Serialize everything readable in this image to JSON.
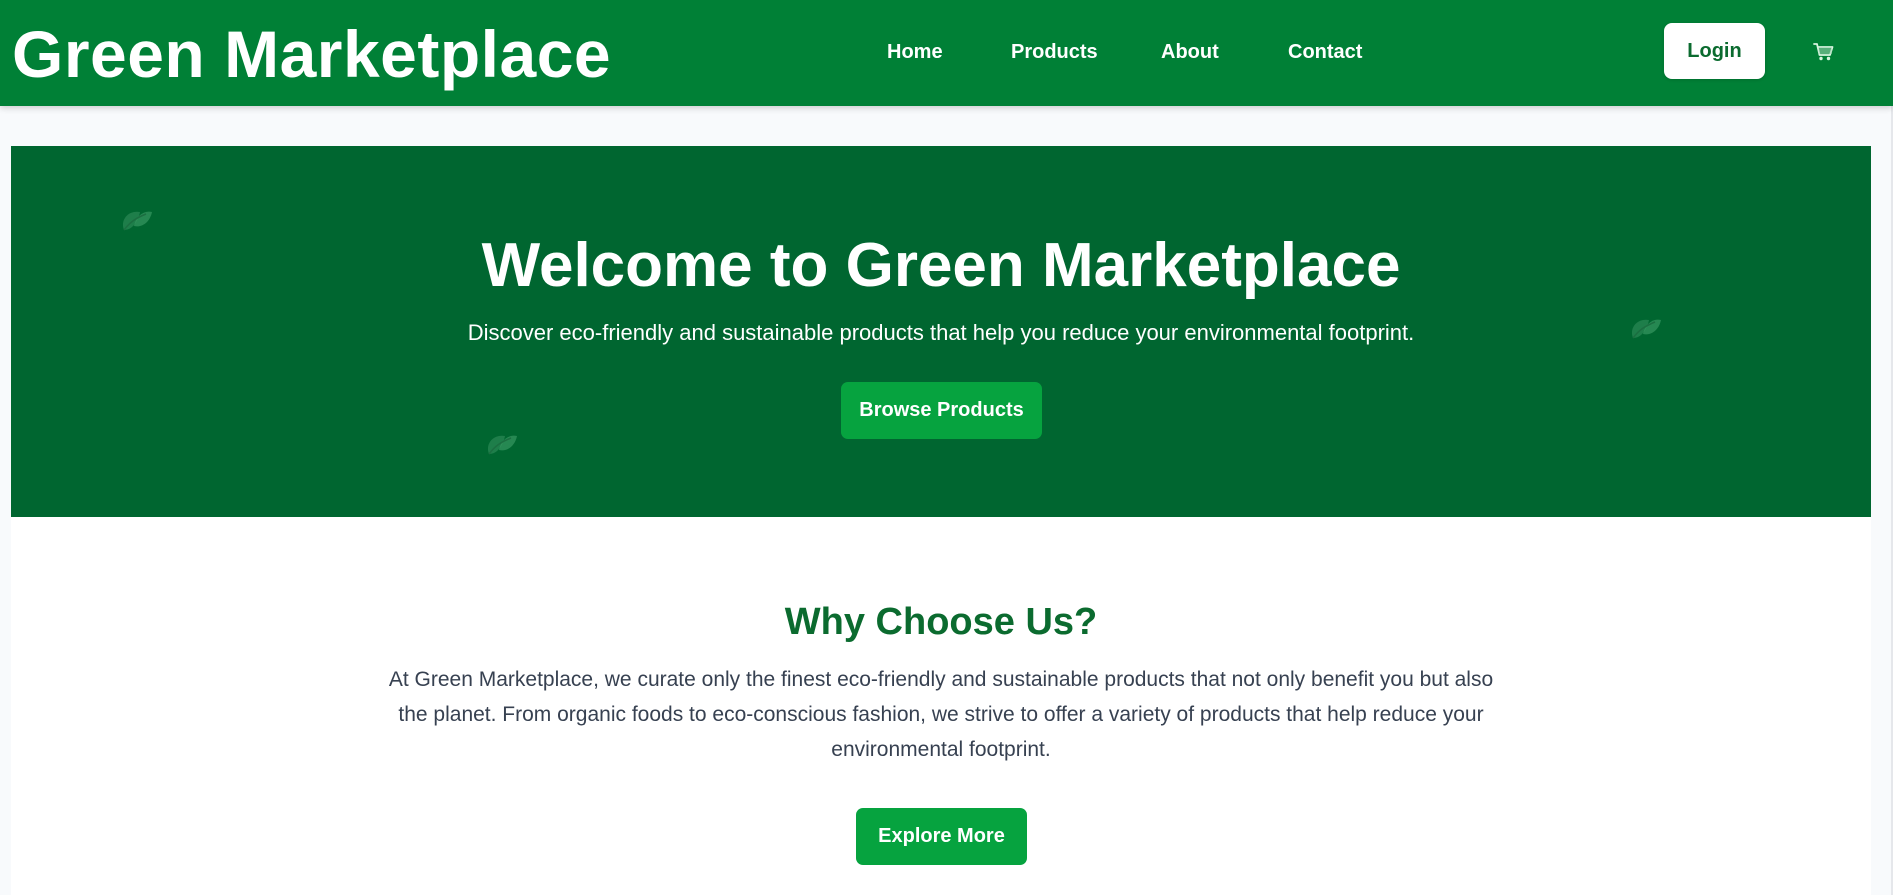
{
  "header": {
    "brand": "Green Marketplace",
    "nav": [
      {
        "label": "Home"
      },
      {
        "label": "Products"
      },
      {
        "label": "About"
      },
      {
        "label": "Contact"
      }
    ],
    "login_label": "Login",
    "cart_icon": "cart-icon"
  },
  "hero": {
    "title": "Welcome to Green Marketplace",
    "subtitle": "Discover eco-friendly and sustainable products that help you reduce your environmental footprint.",
    "cta_label": "Browse Products",
    "decor_icon": "leaf-icon"
  },
  "about": {
    "title": "Why Choose Us?",
    "text": "At Green Marketplace, we curate only the finest eco-friendly and sustainable products that not only benefit you but also the planet. From organic foods to eco-conscious fashion, we strive to offer a variety of products that help reduce your environmental footprint.",
    "cta_label": "Explore More"
  },
  "colors": {
    "nav_bg": "#008036",
    "hero_bg": "#006630",
    "button_green": "#06a33f",
    "heading_green": "#0b6b2f",
    "page_bg": "#f8fafc"
  }
}
